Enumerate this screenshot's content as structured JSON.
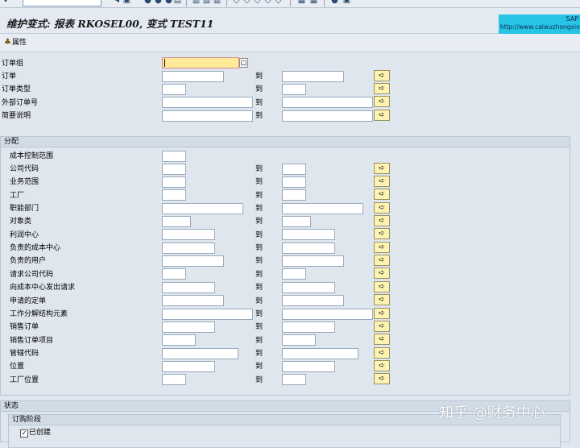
{
  "title": "维护变式: 报表 RKOSEL00, 变式 TEST11",
  "sap_logo": {
    "brand": "SAP",
    "url": "http://www.caiwuzhongxin.cn"
  },
  "toolbar": {
    "attributes_label": "属性"
  },
  "to_label": "到",
  "fields": [
    {
      "label": "订单组"
    },
    {
      "label": "订单"
    },
    {
      "label": "订单类型"
    },
    {
      "label": "外部订单号"
    },
    {
      "label": "简要说明"
    }
  ],
  "assignment": {
    "title": "分配",
    "fields": [
      {
        "label": "成本控制范围"
      },
      {
        "label": "公司代码"
      },
      {
        "label": "业务范围"
      },
      {
        "label": "工厂"
      },
      {
        "label": "职能部门"
      },
      {
        "label": "对象类"
      },
      {
        "label": "利润中心"
      },
      {
        "label": "负责的成本中心"
      },
      {
        "label": "负责的用户"
      },
      {
        "label": "请求公司代码"
      },
      {
        "label": "向成本中心发出请求"
      },
      {
        "label": "申请的定单"
      },
      {
        "label": "工作分解结构元素"
      },
      {
        "label": "销售订单"
      },
      {
        "label": "销售订单项目"
      },
      {
        "label": "管辖代码"
      },
      {
        "label": "位置"
      },
      {
        "label": "工厂位置"
      }
    ]
  },
  "status": {
    "title": "状态",
    "subgroup_title": "订购阶段",
    "created_label": "已创建",
    "created_checked": true
  },
  "watermark": "知乎 @财务中心"
}
